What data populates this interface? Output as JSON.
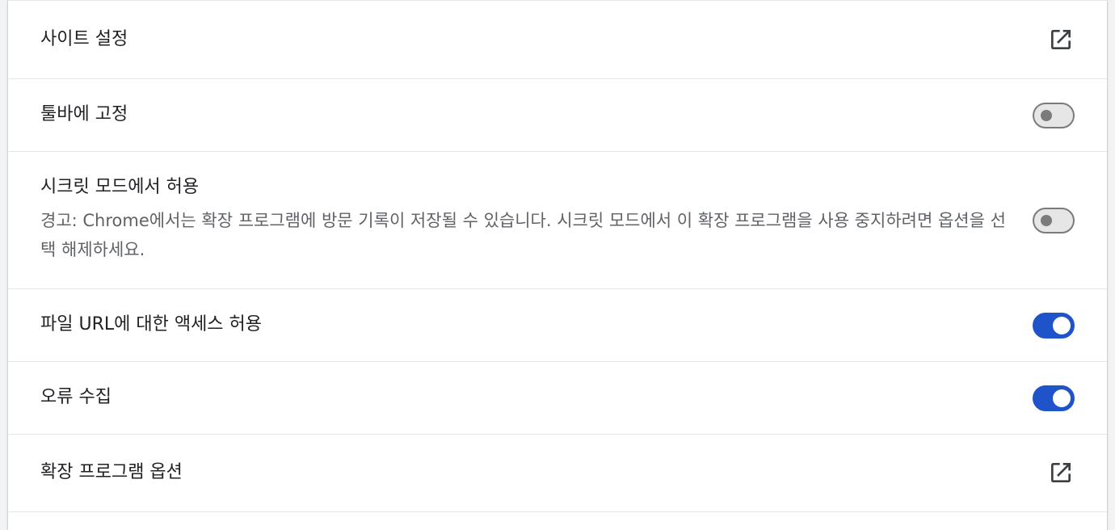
{
  "rows": {
    "site_settings": {
      "label": "사이트 설정",
      "icon": "open-in-new-icon"
    },
    "pin_toolbar": {
      "label": "툴바에 고정",
      "toggle_on": false
    },
    "incognito": {
      "label": "시크릿 모드에서 허용",
      "warning": "경고: Chrome에서는 확장 프로그램에 방문 기록이 저장될 수 있습니다. 시크릿 모드에서 이 확장 프로그램을 사용 중지하려면 옵션을 선택 해제하세요.",
      "toggle_on": false
    },
    "file_urls": {
      "label": "파일 URL에 대한 액세스 허용",
      "toggle_on": true
    },
    "error_collection": {
      "label": "오류 수집",
      "toggle_on": true
    },
    "extension_options": {
      "label": "확장 프로그램 옵션",
      "icon": "open-in-new-icon"
    }
  },
  "colors": {
    "toggle_on": "#1f53c9",
    "toggle_off_track": "#e6e6e6",
    "toggle_off_knob": "#7b7b7b",
    "text_primary": "#202124",
    "text_secondary": "#5f6368"
  }
}
